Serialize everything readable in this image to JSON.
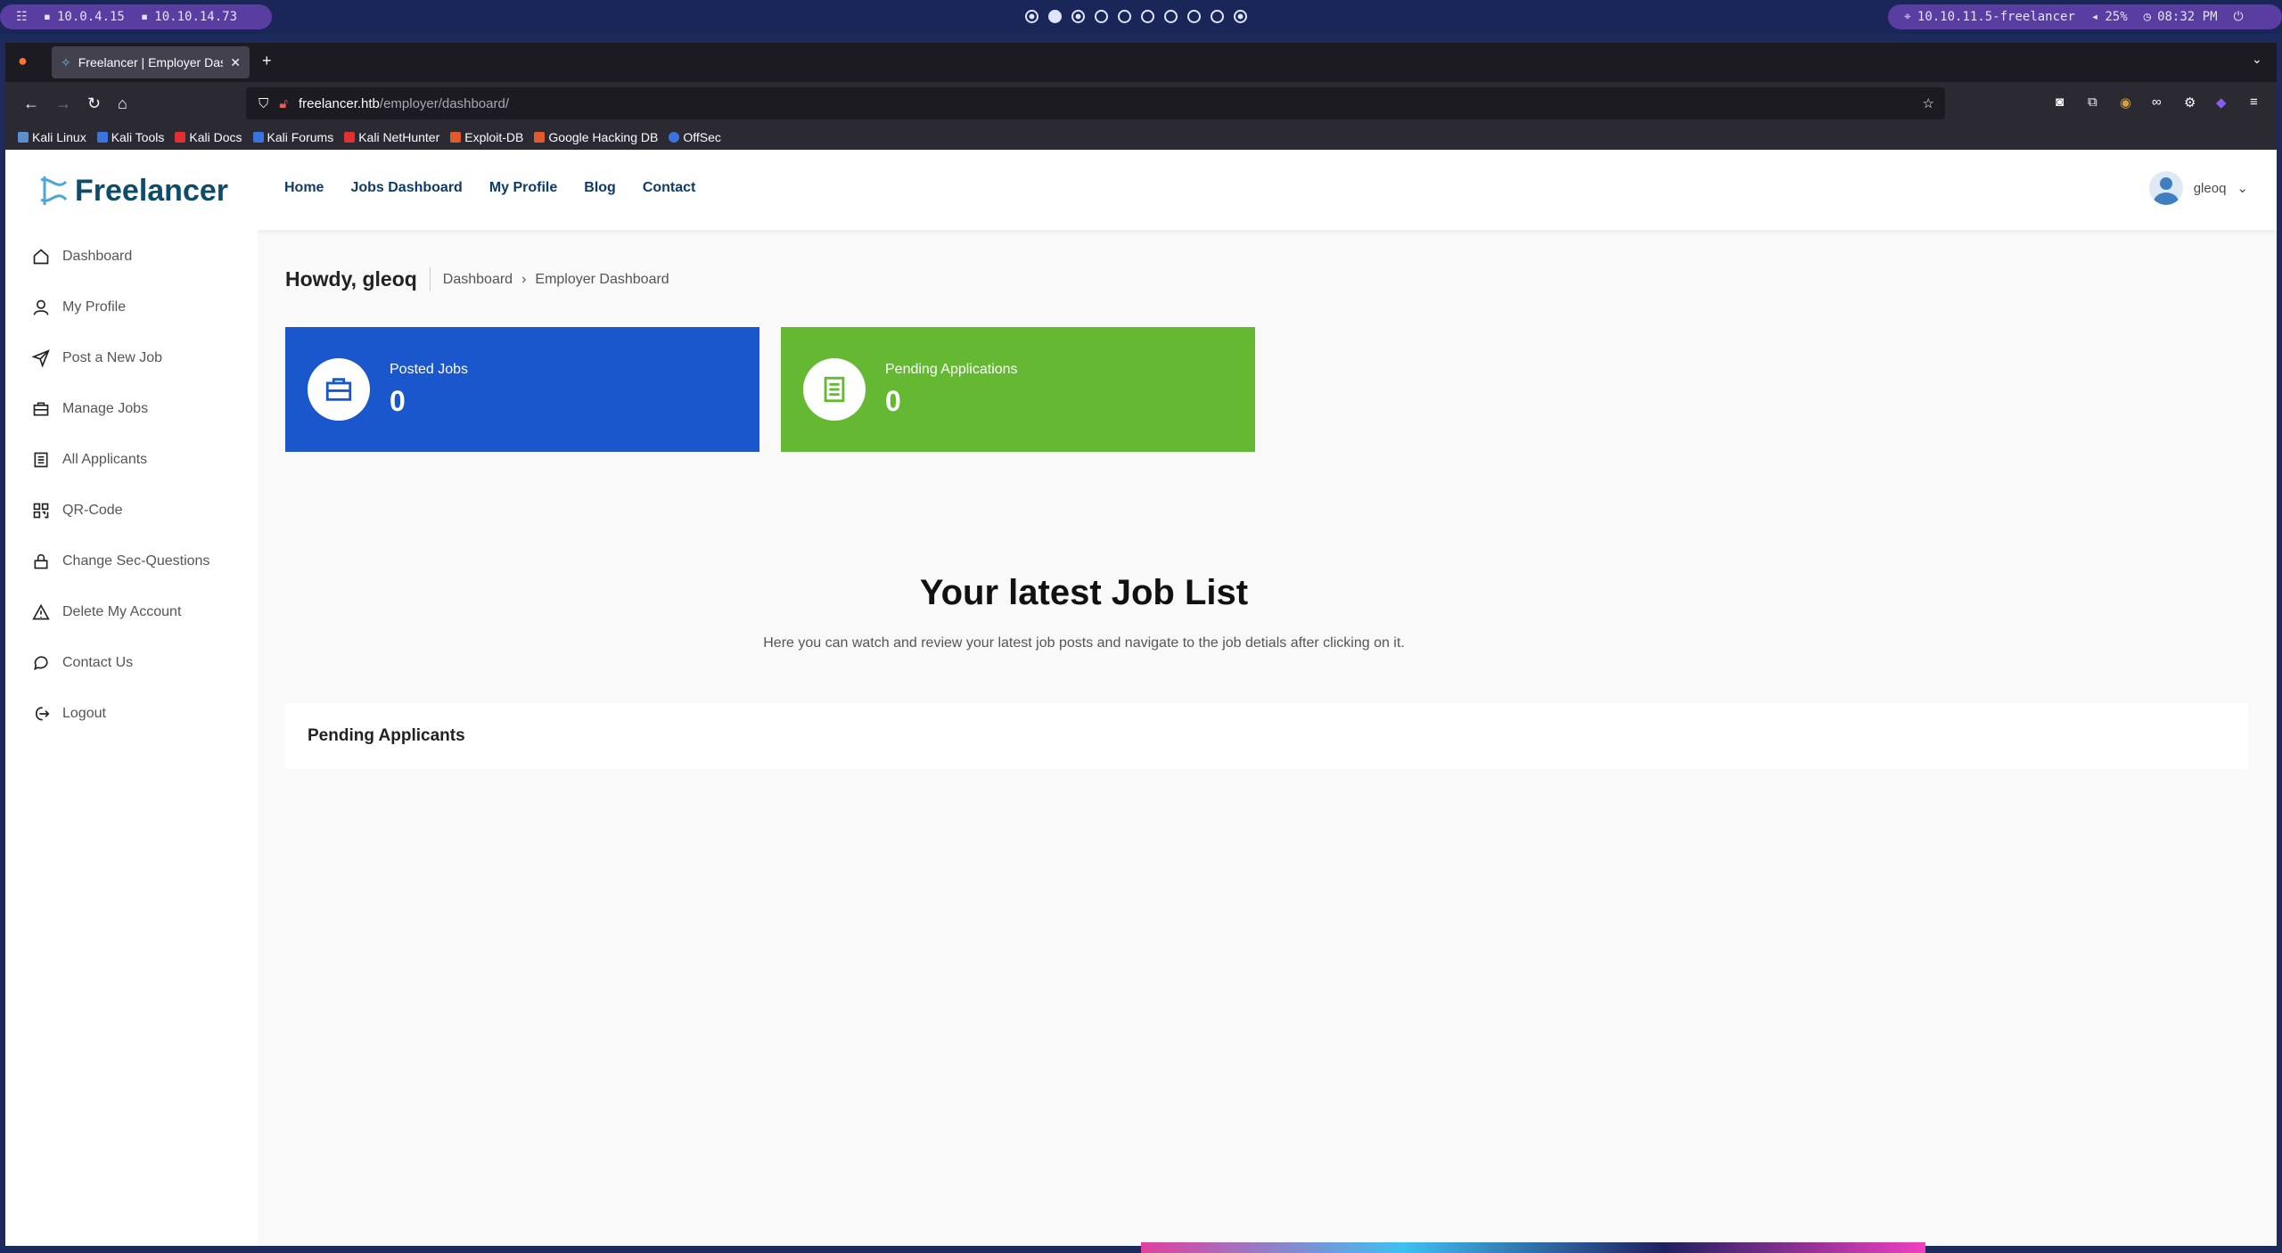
{
  "system_bar": {
    "left_items": [
      "10.0.4.15",
      "10.10.14.73"
    ],
    "right_items": [
      "10.10.11.5-freelancer",
      "25%",
      "08:32 PM"
    ]
  },
  "browser": {
    "tab_title": "Freelancer | Employer Dashboard",
    "url_host": "freelancer.htb",
    "url_path": "/employer/dashboard/",
    "bookmarks": [
      "Kali Linux",
      "Kali Tools",
      "Kali Docs",
      "Kali Forums",
      "Kali NetHunter",
      "Exploit-DB",
      "Google Hacking DB",
      "OffSec"
    ]
  },
  "site": {
    "logo": "Freelancer",
    "nav": [
      "Home",
      "Jobs Dashboard",
      "My Profile",
      "Blog",
      "Contact"
    ],
    "username": "gleoq"
  },
  "sidebar": {
    "items": [
      {
        "label": "Dashboard",
        "icon": "home-icon"
      },
      {
        "label": "My Profile",
        "icon": "user-icon"
      },
      {
        "label": "Post a New Job",
        "icon": "send-icon"
      },
      {
        "label": "Manage Jobs",
        "icon": "briefcase-icon"
      },
      {
        "label": "All Applicants",
        "icon": "document-icon"
      },
      {
        "label": "QR-Code",
        "icon": "qr-code-icon"
      },
      {
        "label": "Change Sec-Questions",
        "icon": "lock-icon"
      },
      {
        "label": "Delete My Account",
        "icon": "warning-icon"
      },
      {
        "label": "Contact Us",
        "icon": "chat-icon"
      },
      {
        "label": "Logout",
        "icon": "logout-icon"
      }
    ]
  },
  "main": {
    "greeting": "Howdy, gleoq",
    "breadcrumb": [
      "Dashboard",
      "Employer Dashboard"
    ],
    "stats": [
      {
        "label": "Posted Jobs",
        "value": "0",
        "color": "#1a56cc"
      },
      {
        "label": "Pending Applications",
        "value": "0",
        "color": "#64b832"
      }
    ],
    "latest_title": "Your latest Job List",
    "latest_subtitle": "Here you can watch and review your latest job posts and navigate to the job detials after clicking on it.",
    "pending_title": "Pending Applicants"
  }
}
